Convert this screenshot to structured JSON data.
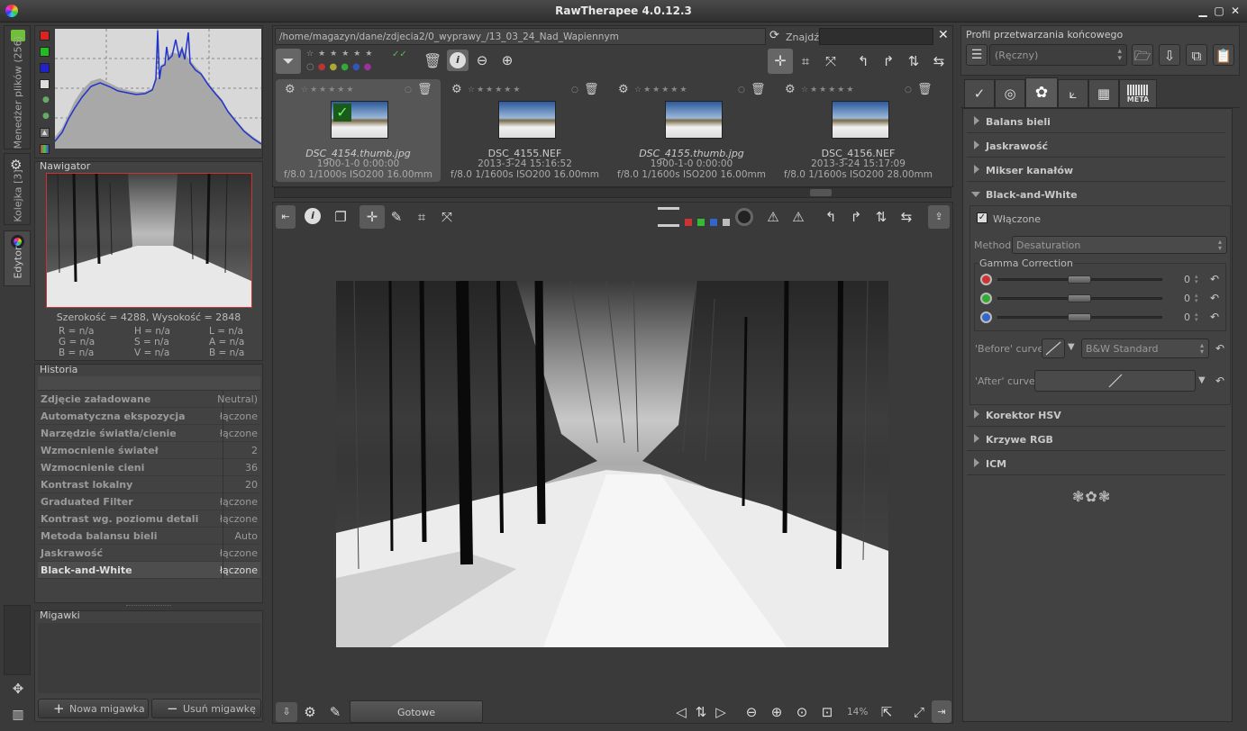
{
  "app": {
    "title": "RawTherapee 4.0.12.3"
  },
  "left_tabs": {
    "file_manager": "Menedżer plików (256)",
    "queue": "Kolejka [3]",
    "editor": "Edytor"
  },
  "navigator": {
    "title": "Nawigator",
    "size_text": "Szerokość = 4288, Wysokość = 2848",
    "readouts": [
      [
        "R = n/a",
        "H = n/a",
        "L = n/a"
      ],
      [
        "G = n/a",
        "S = n/a",
        "A = n/a"
      ],
      [
        "B = n/a",
        "V = n/a",
        "B = n/a"
      ]
    ]
  },
  "history": {
    "title": "Historia",
    "rows": [
      {
        "label": "Zdjęcie załadowane",
        "value": "Neutral)"
      },
      {
        "label": "Automatyczna ekspozycja",
        "value": "łączone"
      },
      {
        "label": "Narzędzie światła/cienie",
        "value": "łączone"
      },
      {
        "label": "Wzmocnienie świateł",
        "value": "2"
      },
      {
        "label": "Wzmocnienie cieni",
        "value": "36"
      },
      {
        "label": "Kontrast lokalny",
        "value": "20"
      },
      {
        "label": "Graduated Filter",
        "value": "łączone"
      },
      {
        "label": "Kontrast wg. poziomu detali",
        "value": "łączone"
      },
      {
        "label": "Metoda balansu bieli",
        "value": "Auto"
      },
      {
        "label": "Jaskrawość",
        "value": "łączone"
      },
      {
        "label": "Black-and-White",
        "value": "łączone"
      }
    ]
  },
  "snapshots": {
    "title": "Migawki",
    "add_label": "Nowa migawka",
    "remove_label": "Usuń migawkę"
  },
  "filebrowser": {
    "path": "/home/magazyn/dane/zdjecia2/0_wyprawy_/13_03_24_Nad_Wapiennym",
    "find_label": "Znajdź:",
    "find_value": "",
    "thumbs": [
      {
        "name": "DSC_4154.thumb.jpg",
        "date": "1900-1-0 0:00:00",
        "exif": "f/8.0 1/1000s ISO200 16.00mm",
        "selected": true
      },
      {
        "name": "DSC_4155.NEF",
        "date": "2013-3-24 15:16:52",
        "exif": "f/8.0 1/1600s ISO200 16.00mm",
        "selected": false
      },
      {
        "name": "DSC_4155.thumb.jpg",
        "date": "1900-1-0 0:00:00",
        "exif": "f/8.0 1/1600s ISO200 16.00mm",
        "selected": false
      },
      {
        "name": "DSC_4156.NEF",
        "date": "2013-3-24 15:17:09",
        "exif": "f/8.0 1/1600s ISO200 28.00mm",
        "selected": false
      }
    ]
  },
  "statusbar": {
    "status": "Gotowe",
    "zoom": "14%"
  },
  "right": {
    "profile_title": "Profil przetwarzania końcowego",
    "profile_value": "(Ręczny)",
    "tab_meta": "META",
    "sections_top": [
      "Balans bieli",
      "Jaskrawość",
      "Mikser kanałów"
    ],
    "bw": {
      "title": "Black-and-White",
      "enabled_label": "Włączone",
      "method_label": "Method:",
      "method_value": "Desaturation",
      "gamma_title": "Gamma Correction",
      "gamma_values": [
        "0",
        "0",
        "0"
      ],
      "before_label": "'Before' curve:",
      "before_value": "B&W Standard",
      "after_label": "'After' curve:"
    },
    "sections_bottom": [
      "Korektor HSV",
      "Krzywe RGB",
      "ICM"
    ]
  }
}
